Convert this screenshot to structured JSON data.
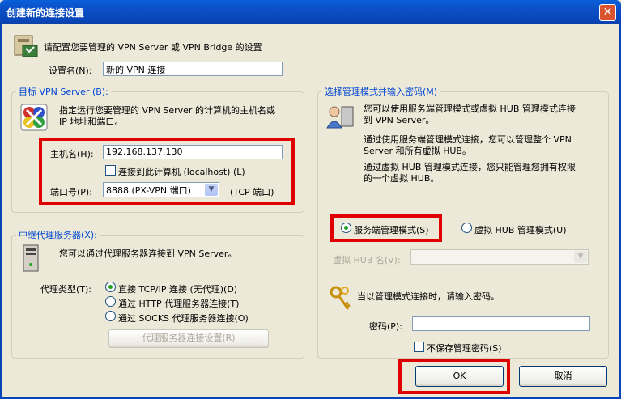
{
  "window": {
    "title": "创建新的连接设置",
    "close_glyph": "✕"
  },
  "header": {
    "text": "请配置您要管理的 VPN Server 或 VPN Bridge 的设置"
  },
  "setting_name": {
    "label": "设置名(N):",
    "value": "新的 VPN 连接"
  },
  "target": {
    "group_label": "目标 VPN Server (B):",
    "desc": [
      "指定运行您要管理的 VPN Server 的计算机的主机名或",
      "IP 地址和端口。"
    ],
    "host_label": "主机名(H):",
    "host_value": "192.168.137.130",
    "localhost_label": "连接到此计算机 (localhost) (L)",
    "port_label": "端口号(P):",
    "port_value": "8888 (PX-VPN 端口)",
    "port_suffix": "(TCP 端口)"
  },
  "proxy": {
    "group_label": "中继代理服务器(X):",
    "desc": "您可以通过代理服务器连接到 VPN Server。",
    "type_label": "代理类型(T):",
    "options": [
      "直接 TCP/IP 连接 (无代理)(D)",
      "通过 HTTP 代理服务器连接(T)",
      "通过 SOCKS 代理服务器连接(O)"
    ],
    "settings_button": "代理服务器连接设置(R)"
  },
  "admin": {
    "group_label": "选择管理模式并输入密码(M)",
    "desc1": [
      "您可以使用服务端管理模式或虚拟 HUB 管理模式连接",
      "到 VPN Server。"
    ],
    "desc2": [
      "通过使用服务端管理模式连接，您可以管理整个 VPN",
      "Server 和所有虚拟 HUB。"
    ],
    "desc3": [
      "通过虚拟 HUB 管理模式连接，您只能管理您拥有权限",
      "的一个虚拟 HUB。"
    ],
    "server_mode": "服务端管理模式(S)",
    "hub_mode": "虚拟 HUB 管理模式(U)",
    "hub_name_label": "虚拟 HUB 名(V):",
    "password_prompt": "当以管理模式连接时，请输入密码。",
    "password_label": "密码(P):",
    "no_save_label": "不保存管理密码(S)"
  },
  "buttons": {
    "ok": "OK",
    "cancel": "取消"
  },
  "colors": {
    "accent": "#0046d5",
    "highlight": "#e00000"
  }
}
